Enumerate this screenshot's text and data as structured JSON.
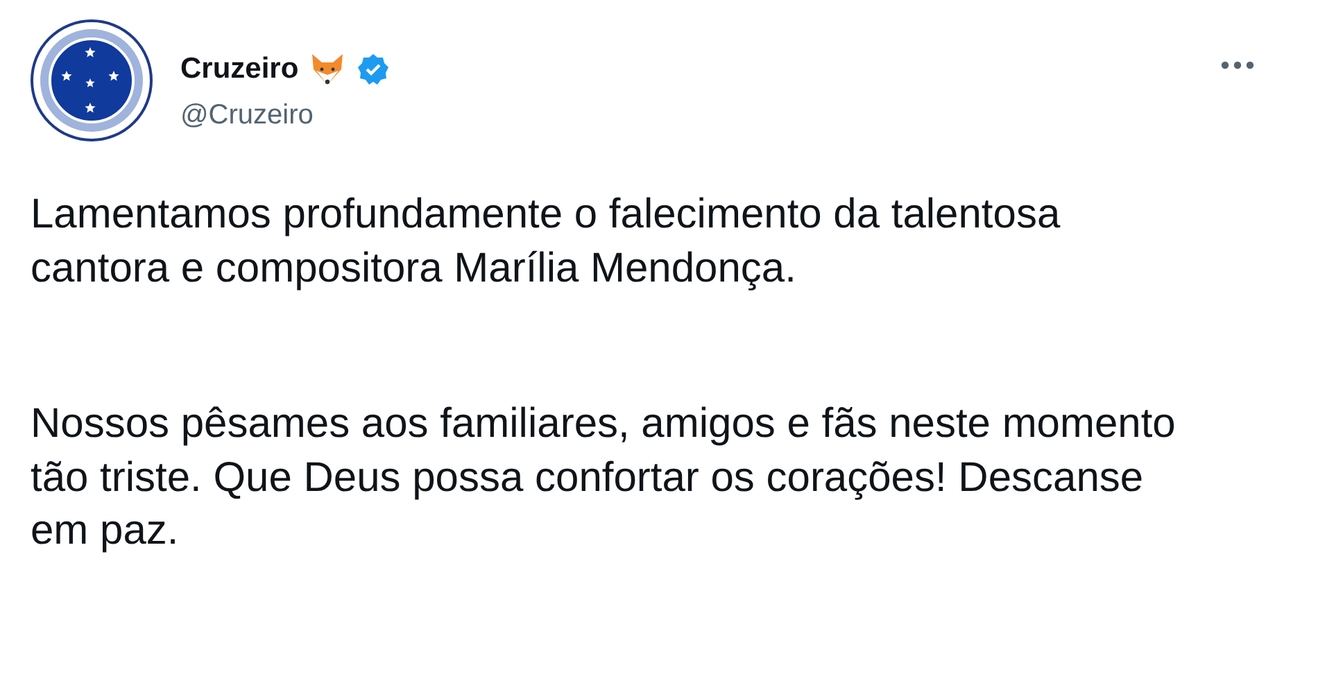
{
  "author": {
    "name": "Cruzeiro",
    "handle": "@Cruzeiro",
    "verified": true
  },
  "paragraphs": [
    "Lamentamos profundamente o falecimento da talentosa cantora e compositora Marília Mendonça.",
    "Nossos pêsames aos familiares, amigos e fãs neste momento tão triste. Que Deus possa confortar os corações! Descanse em paz."
  ]
}
